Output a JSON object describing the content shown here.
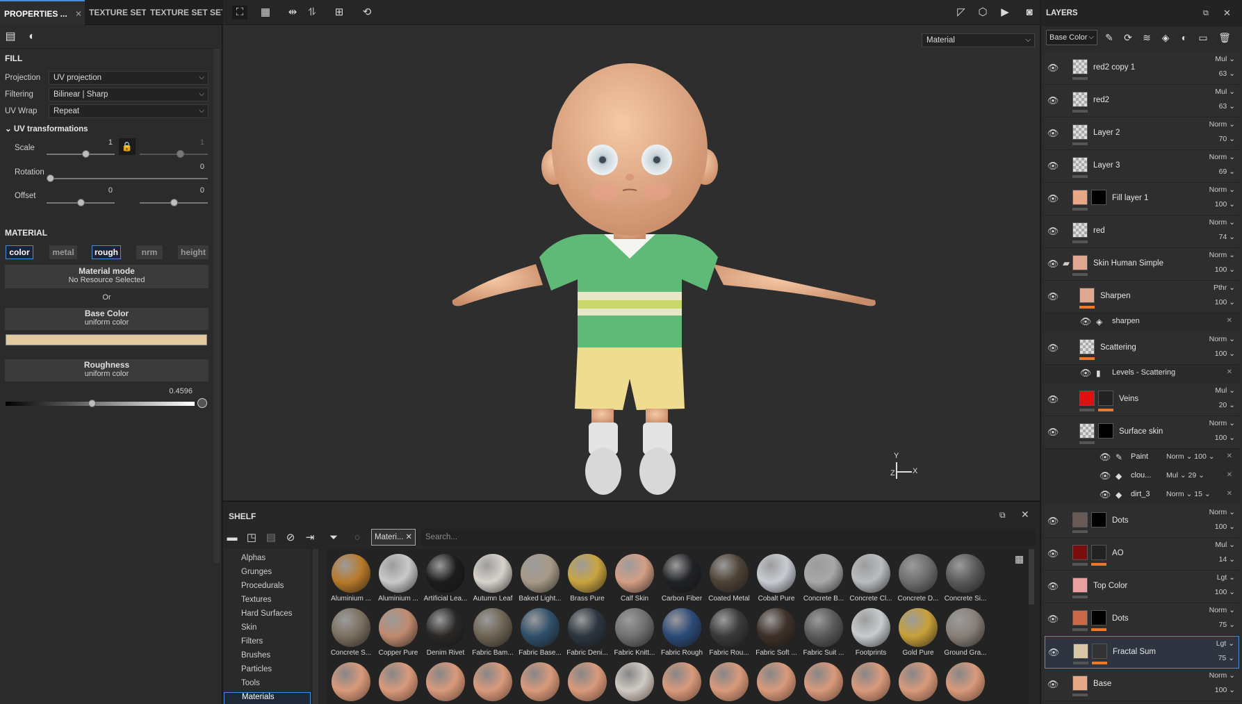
{
  "left_panel": {
    "tabs": [
      "PROPERTIES ...",
      "TEXTURE SET...",
      "TEXTURE SET SET..."
    ],
    "fill": {
      "title": "FILL",
      "projection_label": "Projection",
      "projection_value": "UV projection",
      "filtering_label": "Filtering",
      "filtering_value": "Bilinear | Sharp",
      "uvwrap_label": "UV Wrap",
      "uvwrap_value": "Repeat",
      "uv_transform_title": "UV transformations",
      "scale_label": "Scale",
      "scale_value": "1",
      "scale_value2": "1",
      "rotation_label": "Rotation",
      "rotation_value": "0",
      "offset_label": "Offset",
      "offset_value": "0",
      "offset_value2": "0"
    },
    "material": {
      "title": "MATERIAL",
      "channels": [
        {
          "label": "color",
          "active": true
        },
        {
          "label": "metal",
          "active": false
        },
        {
          "label": "rough",
          "active": true
        },
        {
          "label": "nrm",
          "active": false
        },
        {
          "label": "height",
          "active": false
        }
      ],
      "mode_title": "Material mode",
      "mode_sub": "No Resource Selected",
      "or": "Or",
      "base_color_title": "Base Color",
      "base_color_sub": "uniform color",
      "base_color_swatch": "#e2c9a0",
      "roughness_title": "Roughness",
      "roughness_sub": "uniform color",
      "roughness_value": "0.4596"
    }
  },
  "viewport": {
    "channel_select": "Material",
    "axis_y": "Y",
    "axis_x": "X",
    "axis_z": "Z"
  },
  "shelf": {
    "title": "SHELF",
    "filter_chip": "Materi...",
    "search_placeholder": "Search...",
    "categories": [
      "Alphas",
      "Grunges",
      "Procedurals",
      "Textures",
      "Hard Surfaces",
      "Skin",
      "Filters",
      "Brushes",
      "Particles",
      "Tools",
      "Materials"
    ],
    "active_category": "Materials",
    "materials_row1": [
      {
        "name": "Aluminium ...",
        "color": "#b87a2a"
      },
      {
        "name": "Aluminium ...",
        "color": "#c9c9c9"
      },
      {
        "name": "Artificial Lea...",
        "color": "#1c1c1c"
      },
      {
        "name": "Autumn Leaf",
        "color": "#d8d2cc"
      },
      {
        "name": "Baked Light...",
        "color": "#a89a88"
      },
      {
        "name": "Brass Pure",
        "color": "#c9a440"
      },
      {
        "name": "Calf Skin",
        "color": "#d49e84"
      },
      {
        "name": "Carbon Fiber",
        "color": "#202225"
      },
      {
        "name": "Coated Metal",
        "color": "#4e4236"
      },
      {
        "name": "Cobalt Pure",
        "color": "#c8ccd2"
      },
      {
        "name": "Concrete B...",
        "color": "#a8a8a8"
      },
      {
        "name": "Concrete Cl...",
        "color": "#b9bdc0"
      },
      {
        "name": "Concrete D...",
        "color": "#6e6e6e"
      },
      {
        "name": "Concrete Si...",
        "color": "#5a5a5a"
      }
    ],
    "materials_row2": [
      {
        "name": "Concrete S...",
        "color": "#7c7060"
      },
      {
        "name": "Copper Pure",
        "color": "#c08a6e"
      },
      {
        "name": "Denim Rivet",
        "color": "#2a2826"
      },
      {
        "name": "Fabric Bam...",
        "color": "#6e6454"
      },
      {
        "name": "Fabric Base...",
        "color": "#2f4f6a"
      },
      {
        "name": "Fabric Deni...",
        "color": "#2c3640"
      },
      {
        "name": "Fabric Knitt...",
        "color": "#707070"
      },
      {
        "name": "Fabric Rough",
        "color": "#2c4a78"
      },
      {
        "name": "Fabric Rou...",
        "color": "#3a3a3a"
      },
      {
        "name": "Fabric Soft ...",
        "color": "#3e3028"
      },
      {
        "name": "Fabric Suit ...",
        "color": "#5a5a5a"
      },
      {
        "name": "Footprints",
        "color": "#c8ccce"
      },
      {
        "name": "Gold Pure",
        "color": "#c8a038"
      },
      {
        "name": "Ground Gra...",
        "color": "#888078"
      }
    ],
    "row3_color": "#d99a7c"
  },
  "layers_panel": {
    "title": "LAYERS",
    "channel": "Base Color",
    "layers": [
      {
        "name": "red2 copy 1",
        "blend": "Mul",
        "opacity": "63",
        "thumb": "checker"
      },
      {
        "name": "red2",
        "blend": "Mul",
        "opacity": "63",
        "thumb": "checker"
      },
      {
        "name": "Layer 2",
        "blend": "Norm",
        "opacity": "70",
        "thumb": "checker"
      },
      {
        "name": "Layer 3",
        "blend": "Norm",
        "opacity": "69",
        "thumb": "checker"
      },
      {
        "name": "Fill layer 1",
        "blend": "Norm",
        "opacity": "100",
        "thumb": "#e8a888",
        "mask": "#000000"
      },
      {
        "name": "red",
        "blend": "Norm",
        "opacity": "74",
        "thumb": "checker"
      },
      {
        "name": "Skin Human Simple",
        "blend": "Norm",
        "opacity": "100",
        "thumb": "#e0a890",
        "folder": true
      },
      {
        "name": "Sharpen",
        "blend": "Pthr",
        "opacity": "100",
        "thumb": "#e0a890",
        "bar": "#e87a2a"
      },
      {
        "name": "Scattering",
        "blend": "Norm",
        "opacity": "100",
        "thumb": "checker",
        "bar": "#e87a2a"
      },
      {
        "name": "Veins",
        "blend": "Mul",
        "opacity": "20",
        "thumb": "#e01010",
        "mask": "#222222",
        "bar": "#e87a2a"
      },
      {
        "name": "Surface skin",
        "blend": "Norm",
        "opacity": "100",
        "thumb": "checker",
        "mask": "#000000"
      },
      {
        "name": "Dots",
        "blend": "Norm",
        "opacity": "100",
        "thumb": "#6a5a56",
        "mask": "#000000"
      },
      {
        "name": "AO",
        "blend": "Mul",
        "opacity": "14",
        "thumb": "#7a0e0e",
        "mask": "#222222",
        "bar": "#e87a2a"
      },
      {
        "name": "Top Color",
        "blend": "Lgt",
        "opacity": "100",
        "thumb": "#e8a0a0"
      },
      {
        "name": "Dots",
        "blend": "Norm",
        "opacity": "75",
        "thumb": "#c86a4a",
        "mask": "#000000",
        "bar": "#e87a2a"
      },
      {
        "name": "Fractal Sum",
        "blend": "Lgt",
        "opacity": "75",
        "thumb": "#d8c8a8",
        "mask": "#333333",
        "bar": "#e87a2a"
      },
      {
        "name": "Base",
        "blend": "Norm",
        "opacity": "100",
        "thumb": "#e8a888"
      }
    ],
    "effects": {
      "sharpen": "sharpen",
      "levels": "Levels - Scattering",
      "paint": {
        "name": "Paint",
        "blend": "Norm",
        "opacity": "100"
      },
      "clouds": {
        "name": "clou...",
        "blend": "Mul",
        "opacity": "29"
      },
      "dirt": {
        "name": "dirt_3",
        "blend": "Norm",
        "opacity": "15"
      }
    }
  }
}
